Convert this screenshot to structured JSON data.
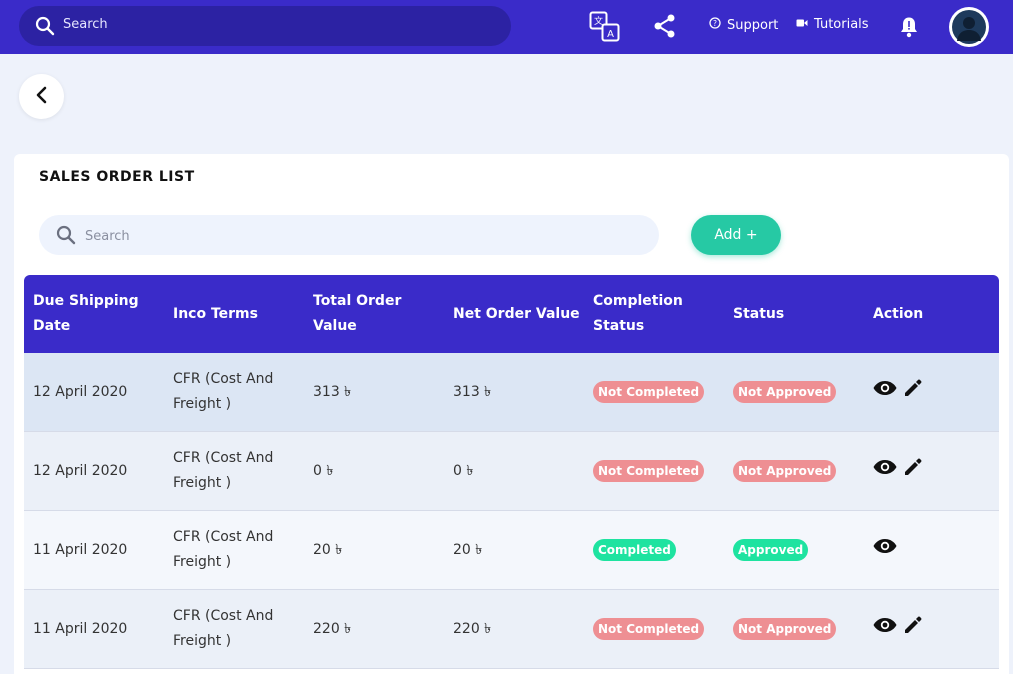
{
  "topbar": {
    "search_placeholder": "Search",
    "support_label": "Support",
    "tutorials_label": "Tutorials"
  },
  "page": {
    "title": "SALES ORDER LIST",
    "search_placeholder": "Search",
    "add_label": "Add +"
  },
  "colors": {
    "primary": "#3a2bc9",
    "accent": "#26c9a4",
    "badge_red": "#ee8f93",
    "badge_green": "#1ee3a0"
  },
  "table": {
    "headers": {
      "due_date": "Due Shipping Date",
      "inco": "Inco Terms",
      "total": "Total Order Value",
      "net": "Net Order Value",
      "completion": "Completion Status",
      "status": "Status",
      "action": "Action"
    },
    "rows": [
      {
        "due_date": "12 April 2020",
        "inco": "CFR (Cost And Freight )",
        "total": "313 ৳",
        "net": "313 ৳",
        "completion": "Not Completed",
        "status": "Not Approved",
        "editable": true
      },
      {
        "due_date": "12 April 2020",
        "inco": "CFR (Cost And Freight )",
        "total": "0 ৳",
        "net": "0 ৳",
        "completion": "Not Completed",
        "status": "Not Approved",
        "editable": true
      },
      {
        "due_date": "11 April 2020",
        "inco": "CFR (Cost And Freight )",
        "total": "20 ৳",
        "net": "20 ৳",
        "completion": "Completed",
        "status": "Approved",
        "editable": false
      },
      {
        "due_date": "11 April 2020",
        "inco": "CFR (Cost And Freight )",
        "total": "220 ৳",
        "net": "220 ৳",
        "completion": "Not Completed",
        "status": "Not Approved",
        "editable": true
      }
    ]
  }
}
